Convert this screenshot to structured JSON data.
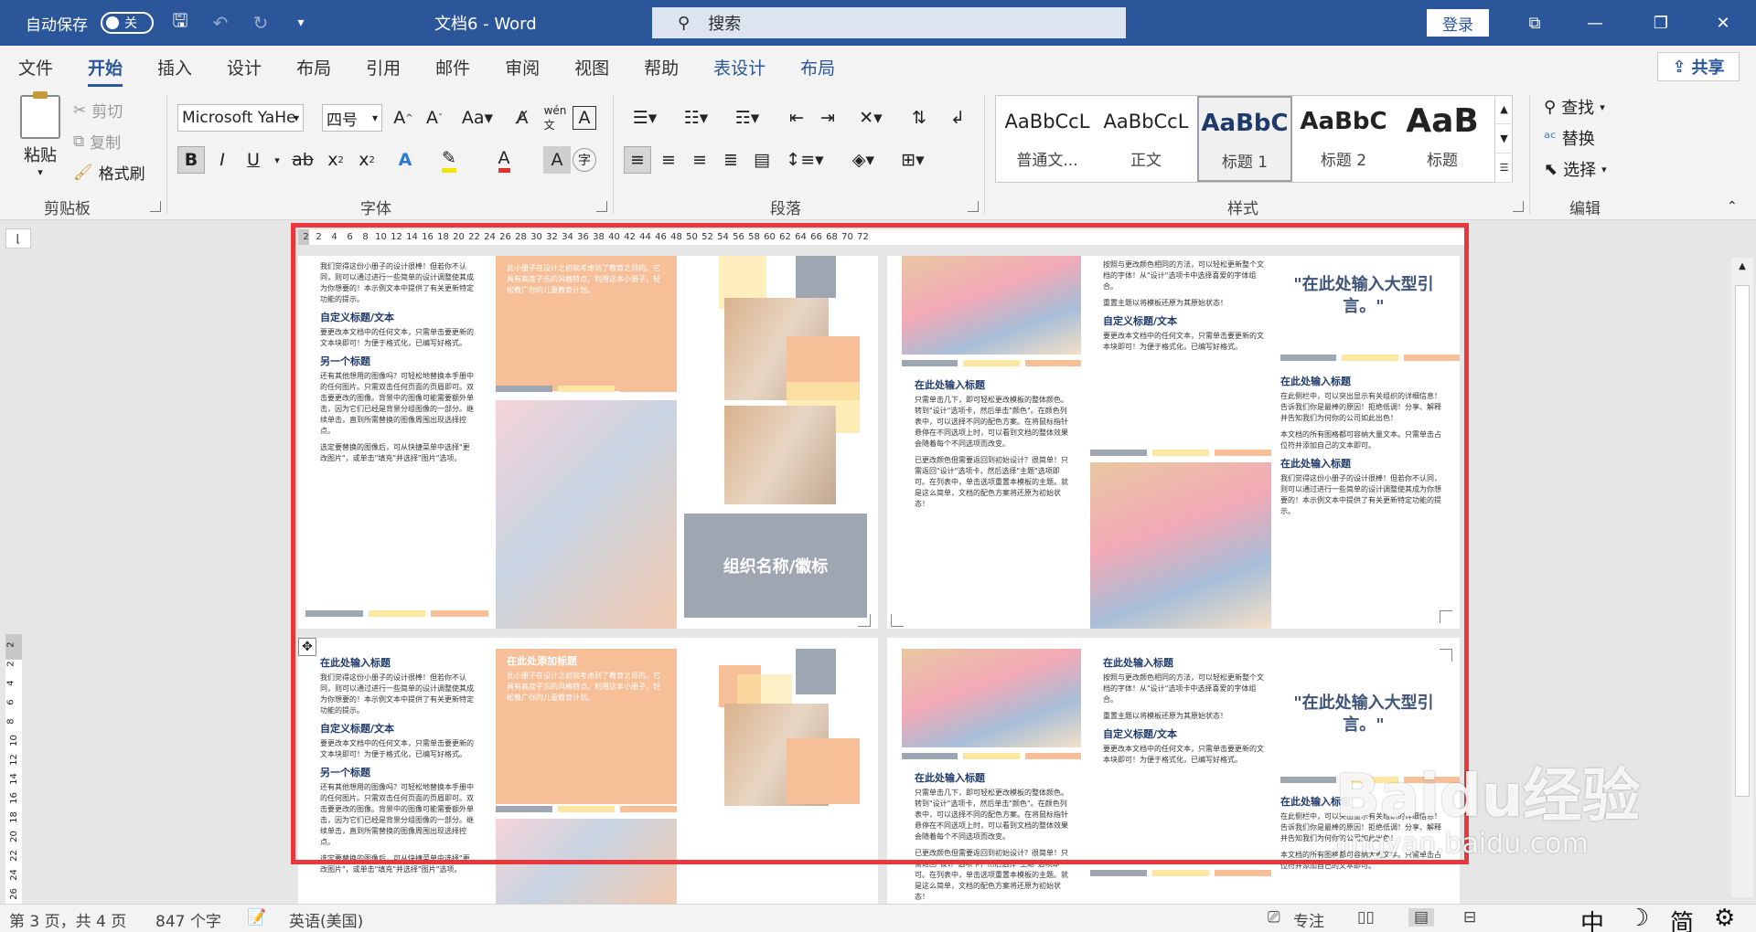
{
  "titlebar": {
    "autosave_label": "自动保存",
    "autosave_state": "关",
    "doc_title": "文档6 - Word",
    "search_placeholder": "搜索",
    "login_label": "登录"
  },
  "tabs": [
    "文件",
    "开始",
    "插入",
    "设计",
    "布局",
    "引用",
    "邮件",
    "审阅",
    "视图",
    "帮助",
    "表设计",
    "布局"
  ],
  "share_label": "共享",
  "clipboard": {
    "paste": "粘贴",
    "cut": "剪切",
    "copy": "复制",
    "format_painter": "格式刷",
    "group": "剪贴板"
  },
  "font": {
    "name": "Microsoft YaHe",
    "size": "四号",
    "group": "字体",
    "color_accent": "#e62e2e",
    "highlight_color": "#f2e600"
  },
  "paragraph": {
    "group": "段落"
  },
  "styles": {
    "group": "样式",
    "items": [
      {
        "sample": "AaBbCcL",
        "name": "普通文..."
      },
      {
        "sample": "AaBbCcL",
        "name": "正文"
      },
      {
        "sample": "AaBbC",
        "name": "标题 1"
      },
      {
        "sample": "AaBbC",
        "name": "标题 2"
      },
      {
        "sample": "AaB",
        "name": "标题"
      }
    ]
  },
  "editing": {
    "find": "查找",
    "replace": "替换",
    "select": "选择",
    "group": "编辑"
  },
  "ruler": {
    "numbers": [
      "2",
      "2",
      "4",
      "6",
      "8",
      "10",
      "12",
      "14",
      "16",
      "18",
      "20",
      "22",
      "24",
      "26",
      "28",
      "30",
      "32",
      "34",
      "36",
      "38",
      "40",
      "42",
      "44",
      "46",
      "48",
      "50",
      "52",
      "54",
      "56",
      "58",
      "60",
      "62",
      "64",
      "66",
      "68",
      "70",
      "72"
    ],
    "vertical_numbers": [
      "2",
      "2",
      "4",
      "6",
      "8",
      "10",
      "12",
      "14",
      "16",
      "18",
      "20",
      "22",
      "24",
      "26"
    ]
  },
  "brochure": {
    "intro_text": "我们觉得这份小册子的设计很棒！但若你不认同，则可以通过进行一些简单的设计调整使其成为你想要的！本示例文本中提供了有关更新特定功能的提示。",
    "heading_custom": "自定义标题/文本",
    "custom_text": "要更改本文档中的任何文本，只需单击要更新的文本块即可！为便于格式化，已编写好格式。",
    "heading_another": "另一个标题",
    "another_text": "还有其他想用的图像吗？可轻松地替换本手册中的任何图片。只需双击任何页面的页眉即可。双击要更改的图像。背景中的图像可能需要额外单击，因为它们已经是背景分组图像的一部分。继续单击，直到所需替换的图像周围出现选择控点。",
    "replace_text": "选定要替换的图像后，可从快捷菜单中选择\"更改图片\"，或单击\"填充\"并选择\"图片\"选项。",
    "peach_heading": "在此处添加标题",
    "peach_text": "此小册子在设计之初就考虑到了教育之目的。它具有高度子乐的风格特点。利用这本小册子，轻松教广你的儿童教育计划。",
    "org_name": "组织名称/徽标",
    "right_text1": "按照与更改颜色相同的方法，可以轻松更新整个文档的字体！从\"设计\"选项卡中选择喜爱的字体组合。",
    "right_text2": "重置主题以将模板还原为其原始状态！",
    "heading_input": "在此处输入标题",
    "theme_text": "只需单击几下，即可轻松更改模板的整体颜色。转到\"设计\"选项卡，然后单击\"颜色\"。在颜色列表中，可以选择不同的配色方案。在将鼠标指针悬停在不同选项上时，可以看到文档的整体效果会随着每个不同选项而改变。",
    "theme_text2": "已更改颜色但需要返回到初始设计？很简单！只需返回\"设计\"选项卡，然后选择\"主题\"选项即可。在列表中，单击选项重置本模板的主题。就是这么简单，文档的配色方案将还原为初始状态！",
    "big_quote": "\"在此处输入大型引言。\"",
    "sidebar_text1": "在此侧栏中，可以突出显示有关组织的详细信息！告诉我们你是最棒的原因！拒绝低调！分享、解释并告知我们为何你的公司如此出色！",
    "sidebar_text2": "本文档的所有图格都可容纳大量文本。只需单击占位符并添加自己的文本即可。",
    "sidebar_text3": "我们觉得这份小册子的设计很棒！但若你不认同，则可以通过进行一些简单的设计调整使其成为你想要的！本示例文本中提供了有关更新特定功能的提示。",
    "palette": {
      "peach": "#f6bf98",
      "yellow": "#fde7a2",
      "gray": "#9ea6b1"
    }
  },
  "status": {
    "page": "第 3 页，共 4 页",
    "words": "847 个字",
    "language": "英语(美国)",
    "focus": "专注",
    "ime1": "中",
    "ime2": "简"
  },
  "watermark": {
    "brand": "Baidu经验",
    "url": "jingyan.baidu.com"
  }
}
